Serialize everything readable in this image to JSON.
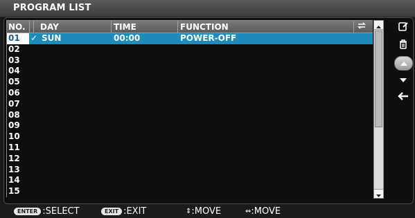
{
  "window": {
    "title": "PROGRAM LIST"
  },
  "table": {
    "headers": {
      "no": "NO.",
      "day": "DAY",
      "time": "TIME",
      "function": "FUNCTION"
    },
    "rows": [
      {
        "no": "01",
        "check": "✓",
        "day": "SUN",
        "time": "00:00",
        "function": "POWER-OFF"
      },
      {
        "no": "02"
      },
      {
        "no": "03"
      },
      {
        "no": "04"
      },
      {
        "no": "05"
      },
      {
        "no": "06"
      },
      {
        "no": "07"
      },
      {
        "no": "08"
      },
      {
        "no": "09"
      },
      {
        "no": "10"
      },
      {
        "no": "11"
      },
      {
        "no": "12"
      },
      {
        "no": "13"
      },
      {
        "no": "14"
      },
      {
        "no": "15"
      }
    ]
  },
  "side_buttons": [
    "edit-icon",
    "delete-icon",
    "up-arrow-icon",
    "down-arrow-icon",
    "back-arrow-icon"
  ],
  "footer": {
    "enter_key": "ENTER",
    "enter_label": ":SELECT",
    "exit_key": "EXIT",
    "exit_label": ":EXIT",
    "updown_label": ":MOVE",
    "leftright_label": ":MOVE"
  },
  "colors": {
    "selected_row": "#1e8bbb",
    "title_bar": "#4a4a4a",
    "panel": "#0e0e0e"
  }
}
